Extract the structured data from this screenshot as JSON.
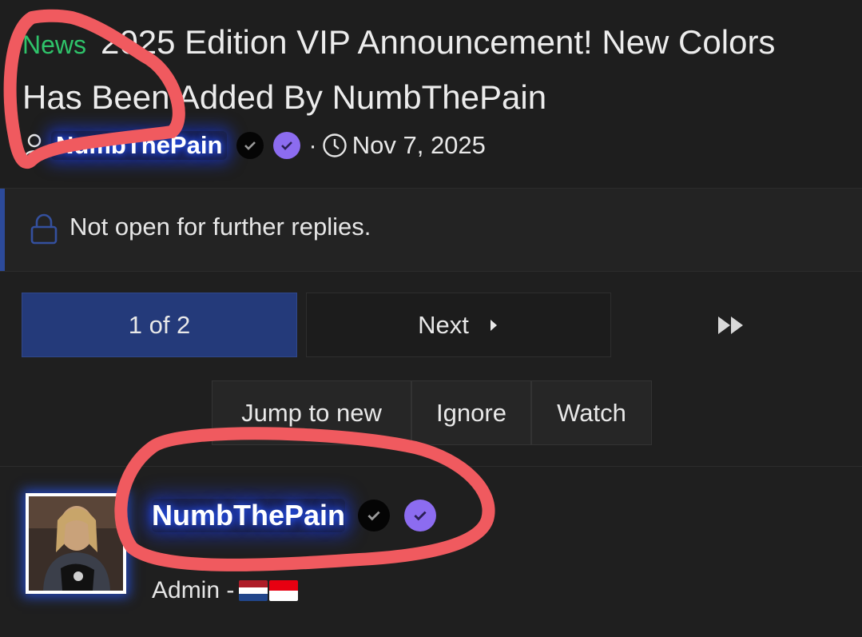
{
  "thread": {
    "prefix": "News",
    "title": "2025 Edition VIP Announcement! New Colors Has Been Added By NumbThePain",
    "author": "NumbThePain",
    "separator": "·",
    "date": "Nov 7, 2025"
  },
  "notice": {
    "text": "Not open for further replies."
  },
  "pagination": {
    "current": "1 of 2",
    "next_label": "Next"
  },
  "actions": {
    "jump": "Jump to new",
    "ignore": "Ignore",
    "watch": "Watch"
  },
  "post": {
    "username": "NumbThePain",
    "role": "Admin -"
  },
  "colors": {
    "accent_blue": "#243a7a",
    "prefix_green": "#2fc36a",
    "verified_purple": "#8c6cf0",
    "annotation_red": "#f05a5f"
  }
}
